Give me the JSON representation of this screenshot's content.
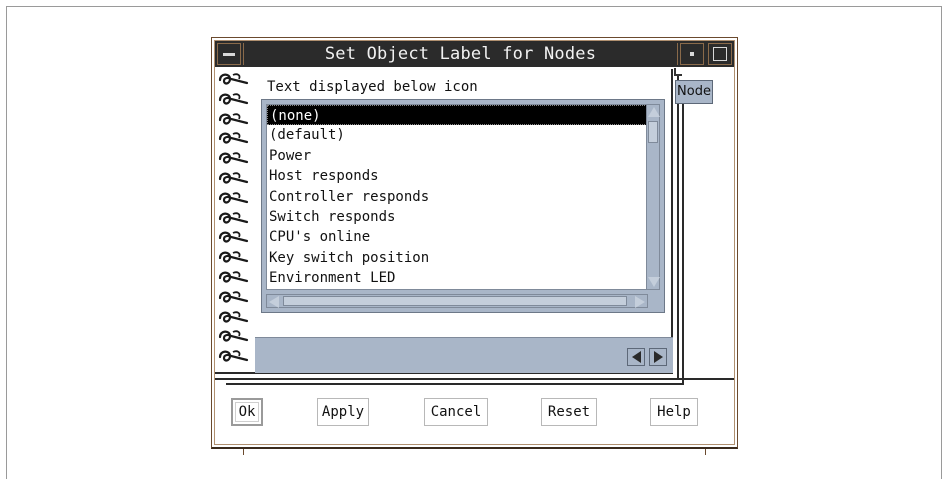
{
  "window": {
    "title": "Set Object Label for Nodes"
  },
  "notebook": {
    "list_label": "Text displayed below icon",
    "items": [
      "(none)",
      "(default)",
      "Power",
      "Host responds",
      "Controller responds",
      "Switch responds",
      "CPU's online",
      "Key switch position",
      "Environment LED"
    ],
    "selected_index": 0,
    "tab_label": "Node"
  },
  "buttons": {
    "ok": "Ok",
    "apply": "Apply",
    "cancel": "Cancel",
    "reset": "Reset",
    "help": "Help"
  },
  "icons": {
    "spiral": "spiral-binding-icon",
    "window_menu": "window-menu-icon",
    "minimize": "minimize-icon",
    "maximize": "maximize-icon"
  },
  "colors": {
    "titlebar": "#2b2b2b",
    "panel": "#a9b6c8",
    "selection": "#000000"
  }
}
